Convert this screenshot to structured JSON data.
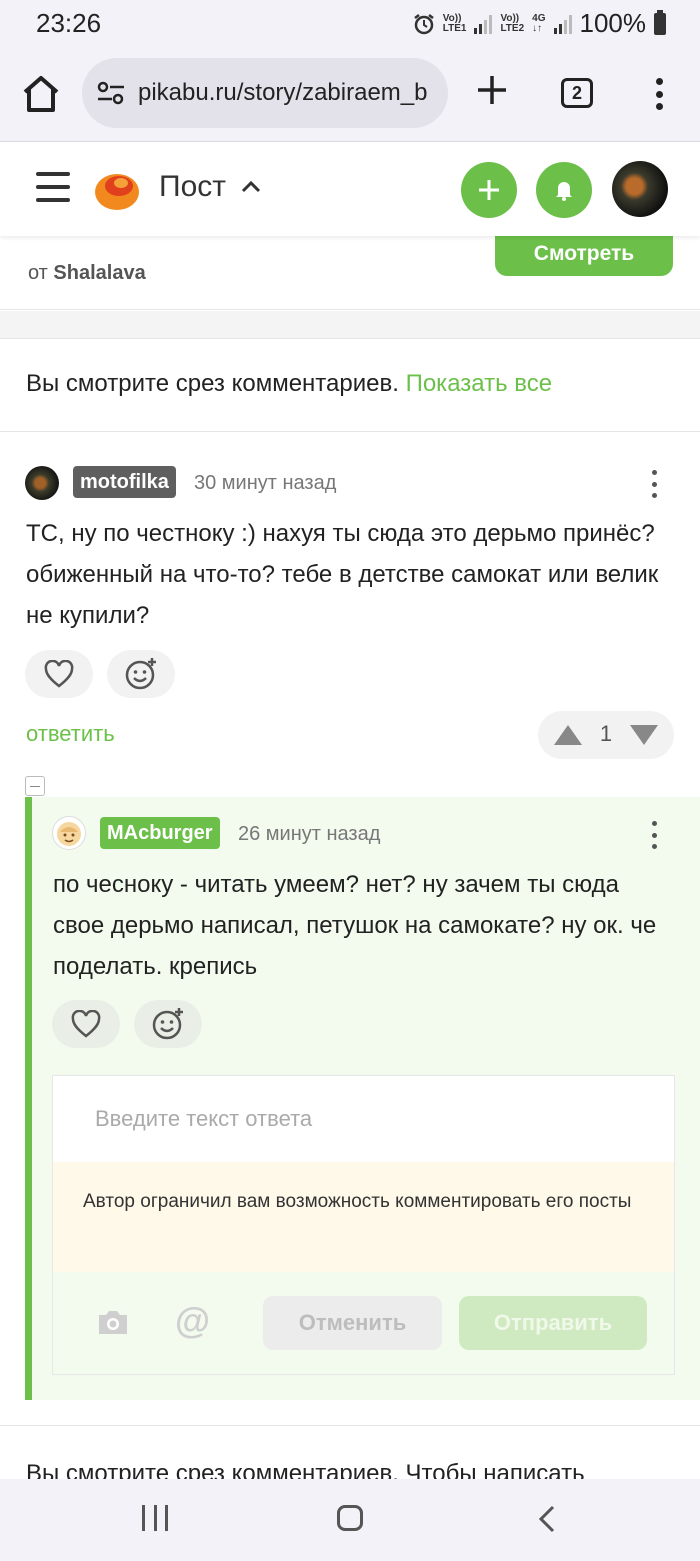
{
  "status_bar": {
    "time": "23:26",
    "sim1_label_top": "Vo))",
    "sim1_label_bottom": "LTE1",
    "sim2_label_top": "Vo))",
    "sim2_label_bottom": "LTE2",
    "network": "4G",
    "battery": "100%"
  },
  "browser": {
    "url": "pikabu.ru/story/zabiraem_b",
    "tab_count": "2"
  },
  "header": {
    "title": "Пост",
    "accent_color": "#6cc04a"
  },
  "top_card": {
    "from_prefix": "от",
    "author": "Shalalava",
    "watch_button": "Смотреть"
  },
  "slice_notice": {
    "text": "Вы смотрите срез комментариев.",
    "show_all": "Показать все"
  },
  "comments": [
    {
      "username": "motofilka",
      "time": "30 минут назад",
      "text": "ТС, ну по честноку :) нахуя ты сюда это дерьмо принёс? обиженный на что-то? тебе в детстве самокат или велик не купили?",
      "reply_label": "ответить",
      "rating": "1"
    },
    {
      "username": "MAcburger",
      "time": "26 минут назад",
      "text": "по чесноку - читать умеем? нет? ну зачем ты сюда свое дерьмо написал, петушок на самокате? ну ок. че поделать. крепись"
    }
  ],
  "reply_form": {
    "placeholder": "Введите текст ответа",
    "restriction": "Автор ограничил вам возможность комментировать его посты",
    "cancel": "Отменить",
    "send": "Отправить"
  },
  "bottom_notice": {
    "text": "Вы смотрите срез комментариев. Чтобы написать"
  }
}
